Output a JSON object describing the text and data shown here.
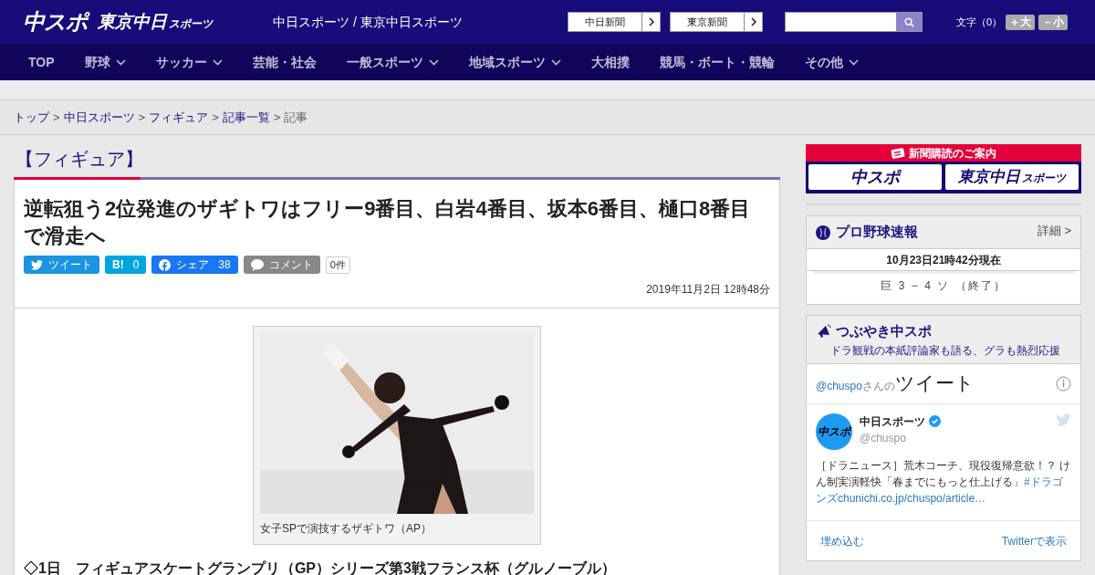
{
  "header": {
    "logo": "中スポ",
    "logo_sub": {
      "main": "東京中日",
      "small": "スポーツ"
    },
    "site_title": "中日スポーツ / 東京中日スポーツ",
    "links": [
      "中日新聞",
      "東京新聞"
    ],
    "font_size": {
      "label": "文字（0）",
      "buttons": [
        "＋大",
        "－小"
      ]
    }
  },
  "nav": [
    {
      "label": "TOP",
      "has_menu": false
    },
    {
      "label": "野球",
      "has_menu": true
    },
    {
      "label": "サッカー",
      "has_menu": true
    },
    {
      "label": "芸能・社会",
      "has_menu": false
    },
    {
      "label": "一般スポーツ",
      "has_menu": true
    },
    {
      "label": "地域スポーツ",
      "has_menu": true
    },
    {
      "label": "大相撲",
      "has_menu": false
    },
    {
      "label": "競馬・ボート・競輪",
      "has_menu": false
    },
    {
      "label": "その他",
      "has_menu": true
    }
  ],
  "breadcrumb": [
    {
      "kind": "link",
      "label": "トップ"
    },
    {
      "kind": "sep",
      "label": ">"
    },
    {
      "kind": "link",
      "label": "中日スポーツ"
    },
    {
      "kind": "sep",
      "label": ">"
    },
    {
      "kind": "link",
      "label": "フィギュア"
    },
    {
      "kind": "sep",
      "label": ">"
    },
    {
      "kind": "link",
      "label": "記事一覧"
    },
    {
      "kind": "sep",
      "label": ">"
    },
    {
      "kind": "current",
      "label": "記事"
    }
  ],
  "category": "【フィギュア】",
  "article": {
    "title": "逆転狙う2位発進のザギトワはフリー9番目、白岩4番目、坂本6番目、樋口8番目で滑走へ",
    "share": [
      {
        "kind": "twitter",
        "label": "ツイート"
      },
      {
        "kind": "hatena",
        "label": "B!",
        "count": "0"
      },
      {
        "kind": "facebook",
        "label": "シェア",
        "count": "38"
      },
      {
        "kind": "comment",
        "label": "コメント",
        "count": "0件"
      }
    ],
    "date": "2019年11月2日 12時48分",
    "photo": {
      "caption": "女子SPで演技するザギトワ（AP）"
    },
    "lead": "◇1日　フィギュアスケートグランプリ（GP）シリーズ第3戦フランス杯（グルノーブル）"
  },
  "sidebar": {
    "subscription": {
      "title": "新聞購読のご案内",
      "logo": "中スポ",
      "logo_sub": {
        "main": "東京中日",
        "small": "スポーツ"
      }
    },
    "baseball": {
      "title": "プロ野球速報",
      "detail": "詳細 >",
      "updated": "10月23日21時42分現在",
      "score": "巨 3 − 4 ソ （終了）"
    },
    "tweets": {
      "title": "つぶやき中スポ",
      "subtitle": "ドラ観戦の本紙評論家も語る、グラも熱烈応援",
      "handle": "@chuspo",
      "handle_suffix": "さんの",
      "heading": "ツイート",
      "tweet": {
        "avatar": "中スポ",
        "name": "中日スポーツ",
        "verified": true,
        "handle": "@chuspo",
        "text": "［ドラニュース］荒木コーチ、現役復帰意欲！？ けん制実演軽快「春までにもっと仕上げる」",
        "link": "#ドラゴンズchunichi.co.jp/chuspo/article…"
      },
      "footer": [
        "埋め込む",
        "Twitterで表示"
      ]
    }
  }
}
